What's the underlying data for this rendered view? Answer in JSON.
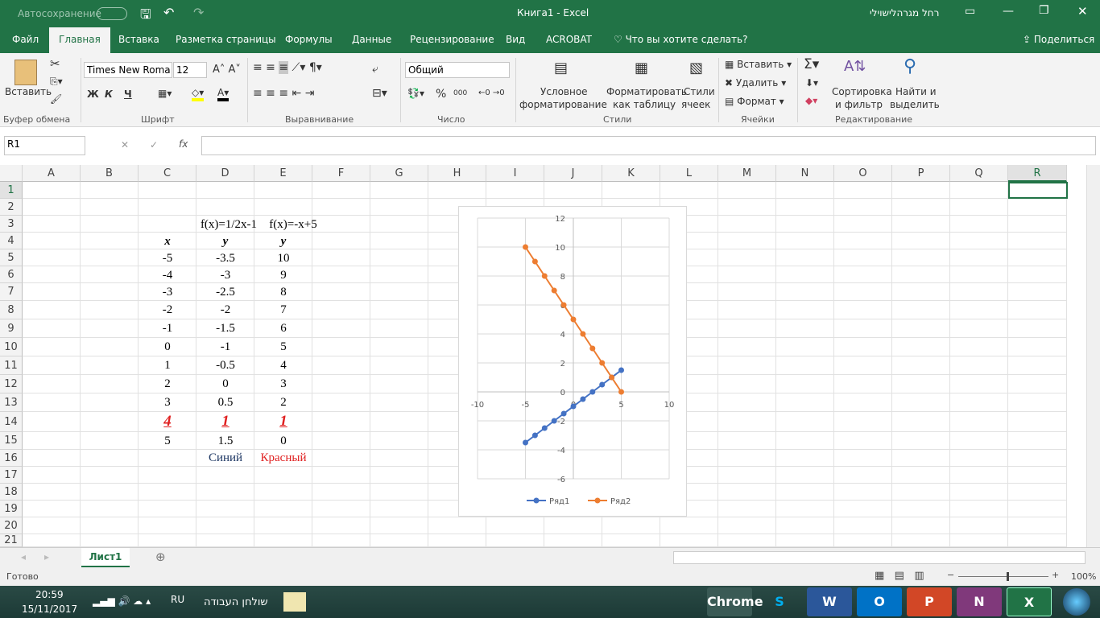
{
  "title": {
    "autosave": "Автосохранение",
    "doc": "Книга1  -  Excel",
    "user": "רחל מגרהלישוילי"
  },
  "tabs": [
    "Файл",
    "Главная",
    "Вставка",
    "Разметка страницы",
    "Формулы",
    "Данные",
    "Рецензирование",
    "Вид",
    "ACROBAT",
    "Что вы хотите сделать?"
  ],
  "share": "Поделиться",
  "ribbon": {
    "paste": "Вставить",
    "font": "Times New Roma",
    "size": "12",
    "bold": "Ж",
    "italic": "К",
    "underline": "Ч",
    "number_format": "Общий",
    "percent": "%",
    "thousands": "000",
    "cond1": "Условное",
    "cond2": "форматирование",
    "fmt1": "Форматировать",
    "fmt2": "как таблицу",
    "styles1": "Стили",
    "styles2": "ячеек",
    "insert": "Вставить",
    "delete": "Удалить",
    "format": "Формат",
    "sort1": "Сортировка",
    "sort2": "и фильтр",
    "find1": "Найти и",
    "find2": "выделить",
    "groups": [
      "Буфер обмена",
      "Шрифт",
      "Выравнивание",
      "Число",
      "Стили",
      "Ячейки",
      "Редактирование"
    ]
  },
  "formula": {
    "namebox": "R1",
    "fx": "fx",
    "value": ""
  },
  "columns": [
    "A",
    "B",
    "C",
    "D",
    "E",
    "F",
    "G",
    "H",
    "I",
    "J",
    "K",
    "L",
    "M",
    "N",
    "O",
    "P",
    "Q",
    "R"
  ],
  "rows": [
    "1",
    "2",
    "3",
    "4",
    "5",
    "6",
    "7",
    "8",
    "9",
    "10",
    "11",
    "12",
    "13",
    "14",
    "15",
    "16",
    "17",
    "18",
    "19",
    "20",
    "21"
  ],
  "table": {
    "h1": "f(x)=1/2x-1",
    "h2": "f(x)=-x+5",
    "xh": "x",
    "yh1": "y",
    "yh2": "y",
    "x": [
      "-5",
      "-4",
      "-3",
      "-2",
      "-1",
      "0",
      "1",
      "2",
      "3",
      "4",
      "5"
    ],
    "y1": [
      "-3.5",
      "-3",
      "-2.5",
      "-2",
      "-1.5",
      "-1",
      "-0.5",
      "0",
      "0.5",
      "1",
      "1.5"
    ],
    "y2": [
      "10",
      "9",
      "8",
      "7",
      "6",
      "5",
      "4",
      "3",
      "2",
      "1",
      "0"
    ],
    "label1": "Синий",
    "label2": "Красный"
  },
  "chart_data": {
    "type": "scatter",
    "xlim": [
      -10,
      10
    ],
    "ylim": [
      -6,
      12
    ],
    "xticks": [
      "-10",
      "-5",
      "0",
      "5",
      "10"
    ],
    "yticks": [
      "12",
      "10",
      "8",
      "6",
      "4",
      "2",
      "0",
      "-2",
      "-4",
      "-6"
    ],
    "legend_position": "bottom",
    "series": [
      {
        "name": "Ряд1",
        "color": "#4472c4",
        "x": [
          -5,
          -4,
          -3,
          -2,
          -1,
          0,
          1,
          2,
          3,
          4,
          5
        ],
        "y": [
          -3.5,
          -3,
          -2.5,
          -2,
          -1.5,
          -1,
          -0.5,
          0,
          0.5,
          1,
          1.5
        ]
      },
      {
        "name": "Ряд2",
        "color": "#ed7d31",
        "x": [
          -5,
          -4,
          -3,
          -2,
          -1,
          0,
          1,
          2,
          3,
          4,
          5
        ],
        "y": [
          10,
          9,
          8,
          7,
          6,
          5,
          4,
          3,
          2,
          1,
          0
        ]
      }
    ]
  },
  "sheet": {
    "tab": "Лист1"
  },
  "status": {
    "ready": "Готово",
    "zoom": "100%"
  },
  "taskbar": {
    "time": "20:59",
    "date": "15/11/2017",
    "lang": "RU",
    "desktop": "שולחן העבודה",
    "apps": [
      "Chrome",
      "S",
      "W",
      "O",
      "P",
      "N",
      "X"
    ]
  }
}
